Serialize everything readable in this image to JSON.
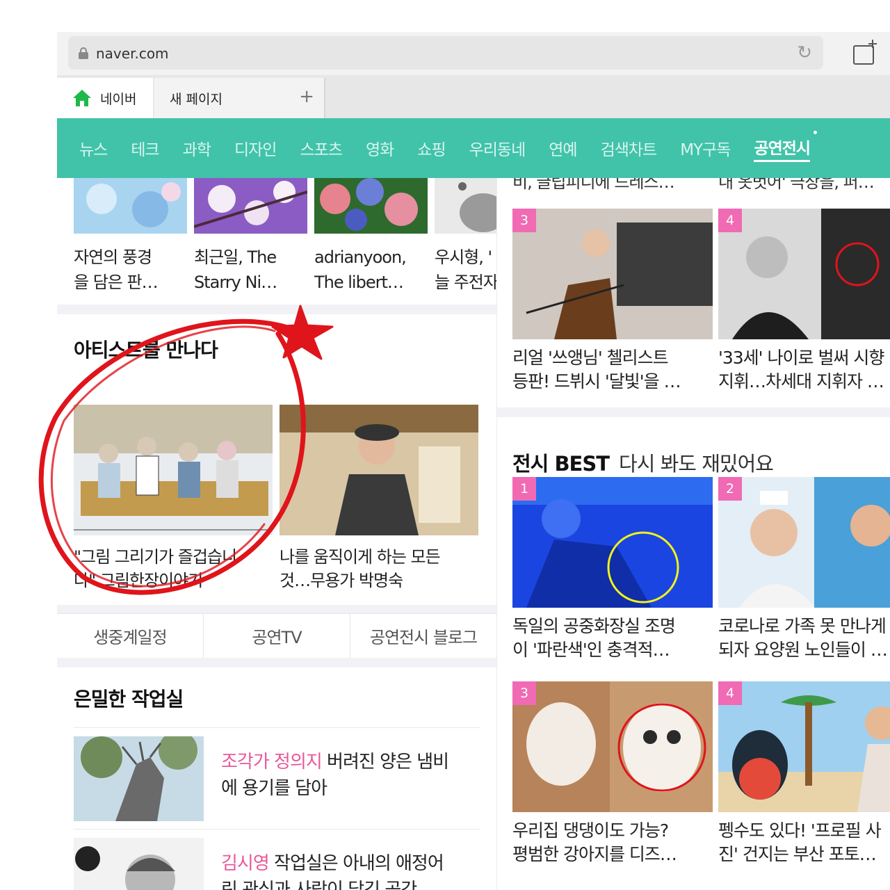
{
  "browser": {
    "url": "naver.com",
    "tabs": [
      {
        "label": "네이버"
      },
      {
        "label": "새 페이지"
      }
    ]
  },
  "nav": {
    "items": [
      "뉴스",
      "테크",
      "과학",
      "디자인",
      "스포츠",
      "영화",
      "쇼핑",
      "우리동네",
      "연예",
      "검색차트",
      "MY구독",
      "공연전시"
    ],
    "active": "공연전시"
  },
  "left": {
    "thumbs": [
      {
        "line1": "자연의 풍경",
        "line2": "을 담은 판…"
      },
      {
        "line1": "최근일, The",
        "line2": "Starry Ni…"
      },
      {
        "line1": "adrianyoon,",
        "line2": "The libert…"
      },
      {
        "line1": "우시형, '",
        "line2": "늘 주전자"
      }
    ],
    "artist_section": {
      "title": "아티스트를 만나다",
      "cards": [
        {
          "line1": "\"그림 그리기가 즐겁습니",
          "line2": "다\" 그림한장이야기"
        },
        {
          "line1": "나를 움직이게 하는 모든",
          "line2": "것…무용가 박명숙"
        }
      ]
    },
    "subtabs": [
      "생중계일정",
      "공연TV",
      "공연전시 블로그"
    ],
    "studio_section": {
      "title": "은밀한 작업실",
      "items": [
        {
          "highlight": "조각가 정의지",
          "rest": " 버려진 양은 냄비",
          "line2": "에 용기를 담아"
        },
        {
          "highlight": "김시영",
          "rest": " 작업실은 아내의 애정어",
          "line2": "린 관심과 사랑이 담긴 공간"
        }
      ]
    }
  },
  "right": {
    "top_cut": [
      "비, 글립피디에 드레스…",
      "내 옷벗어' 극장을, 퍼…"
    ],
    "news": [
      {
        "rank": "3",
        "line1": "리얼 '쓰앵님' 첼리스트",
        "line2": "등판! 드뷔시 '달빛'을 …"
      },
      {
        "rank": "4",
        "line1": "'33세' 나이로 벌써 시향",
        "line2": "지휘…차세대 지휘자 …"
      }
    ],
    "best": {
      "title_bold": "전시 BEST",
      "title_rest": "다시 봐도 재밌어요",
      "items": [
        {
          "rank": "1",
          "line1": "독일의 공중화장실 조명",
          "line2": "이 '파란색'인 충격적…"
        },
        {
          "rank": "2",
          "line1": "코로나로 가족 못 만나게",
          "line2": "되자 요양원 노인들이 …"
        },
        {
          "rank": "3",
          "line1": "우리집 댕댕이도 가능?",
          "line2": "평범한 강아지를 디즈…"
        },
        {
          "rank": "4",
          "line1": "펭수도 있다! '프로필 사",
          "line2": "진' 건지는 부산 포토…"
        }
      ]
    }
  },
  "colors": {
    "nav_bg": "#40c3a9",
    "rank_badge": "#f06ab4",
    "highlight": "#e8579a",
    "annotation_red": "#e0141b"
  }
}
